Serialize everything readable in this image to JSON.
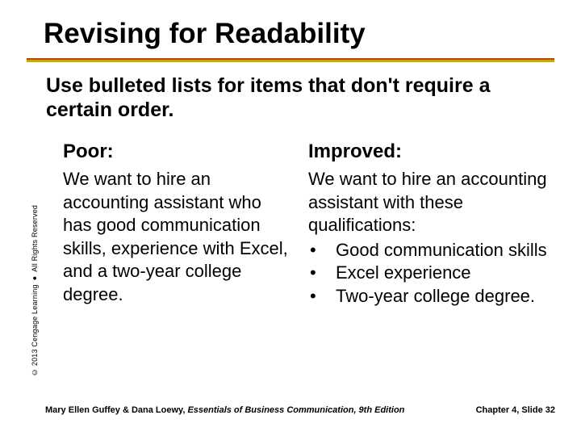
{
  "title": "Revising for Readability",
  "subtitle": "Use bulleted lists for items that don't require a certain order.",
  "left": {
    "heading": "Poor:",
    "text": "We want to hire an accounting assistant who has good communication skills, experience with Excel, and a two-year college degree."
  },
  "right": {
    "heading": "Improved:",
    "intro": "We want to hire an accounting assistant with these qualifications:",
    "bullets": [
      "Good communication skills",
      "Excel experience",
      "Two-year college degree."
    ]
  },
  "side_copyright": {
    "part1": "© 2013 Cengage Learning",
    "dot": "●",
    "part2": "All Rights Reserved"
  },
  "footer": {
    "authors": "Mary Ellen Guffey & Dana Loewy, ",
    "book": "Essentials of Business Communication, 9th Edition",
    "right": "Chapter 4, Slide 32"
  },
  "bullet_mark": "•"
}
